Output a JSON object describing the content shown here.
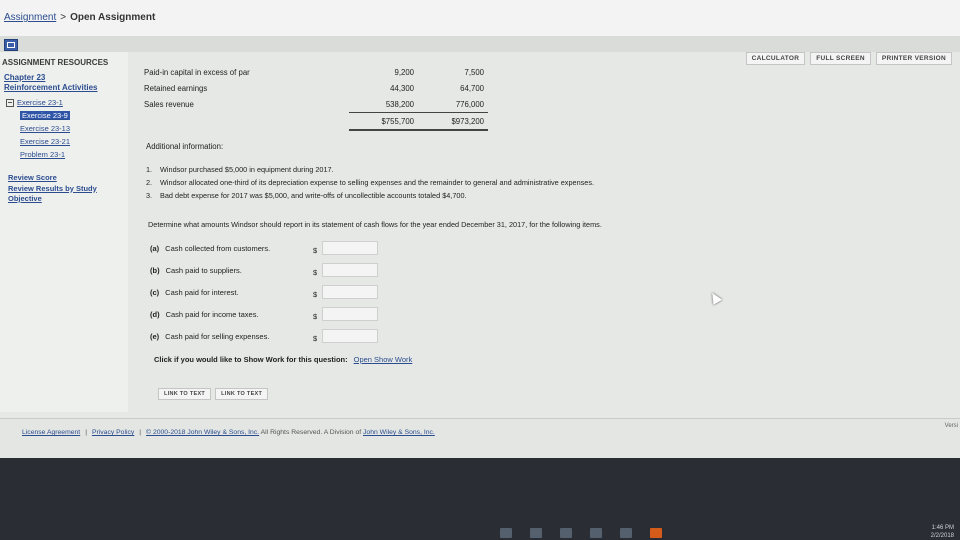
{
  "breadcrumb": {
    "parent": "Assignment",
    "separator": ">",
    "current": "Open Assignment"
  },
  "sidebar": {
    "title": "ASSIGNMENT RESOURCES",
    "chapter_line1": "Chapter 23",
    "chapter_line2": "Reinforcement Activities",
    "items": [
      {
        "label": "Exercise 23-1"
      },
      {
        "label": "Exercise 23-9"
      },
      {
        "label": "Exercise 23-13"
      },
      {
        "label": "Exercise 23-21"
      },
      {
        "label": "Problem 23-1"
      }
    ],
    "review_score": "Review Score",
    "review_results_line1": "Review Results by Study",
    "review_results_line2": "Objective"
  },
  "toolbar": {
    "calculator": "CALCULATOR",
    "full_screen": "FULL SCREEN",
    "printer_version": "PRINTER VERSION"
  },
  "financials": {
    "rows": [
      {
        "label": "Paid-in capital in excess of par",
        "col1": "9,200",
        "col2": "7,500"
      },
      {
        "label": "Retained earnings",
        "col1": "44,300",
        "col2": "64,700"
      },
      {
        "label": "Sales revenue",
        "col1": "538,200",
        "col2": "776,000"
      }
    ],
    "total": {
      "col1": "$755,700",
      "col2": "$973,200"
    }
  },
  "additional_info_heading": "Additional information:",
  "info_items": [
    {
      "num": "1.",
      "text": "Windsor purchased $5,000 in equipment during 2017."
    },
    {
      "num": "2.",
      "text": "Windsor allocated one-third of its depreciation expense to selling expenses and the remainder to general and administrative expenses."
    },
    {
      "num": "3.",
      "text": "Bad debt expense for 2017 was $5,000, and write-offs of uncollectible accounts totaled $4,700."
    }
  ],
  "question": "Determine what amounts Windsor should report in its statement of cash flows for the year ended December 31, 2017, for the following items.",
  "answers": [
    {
      "letter": "(a)",
      "label": "Cash collected from customers.",
      "currency": "$",
      "value": ""
    },
    {
      "letter": "(b)",
      "label": "Cash paid to suppliers.",
      "currency": "$",
      "value": ""
    },
    {
      "letter": "(c)",
      "label": "Cash paid for interest.",
      "currency": "$",
      "value": ""
    },
    {
      "letter": "(d)",
      "label": "Cash paid for income taxes.",
      "currency": "$",
      "value": ""
    },
    {
      "letter": "(e)",
      "label": "Cash paid for selling expenses.",
      "currency": "$",
      "value": ""
    }
  ],
  "show_work": {
    "prompt": "Click if you would like to Show Work for this question:",
    "link": "Open Show Work"
  },
  "link_buttons": [
    "LINK TO TEXT",
    "LINK TO TEXT"
  ],
  "footer": {
    "license": "License Agreement",
    "privacy": "Privacy Policy",
    "sep": "|",
    "copyright": "© 2000-2018 John Wiley & Sons, Inc.",
    "rights": "All Rights Reserved. A Division of",
    "company": "John Wiley & Sons, Inc.",
    "version": "Versi"
  },
  "taskbar": {
    "time": "1:46 PM",
    "date": "2/2/2018"
  }
}
